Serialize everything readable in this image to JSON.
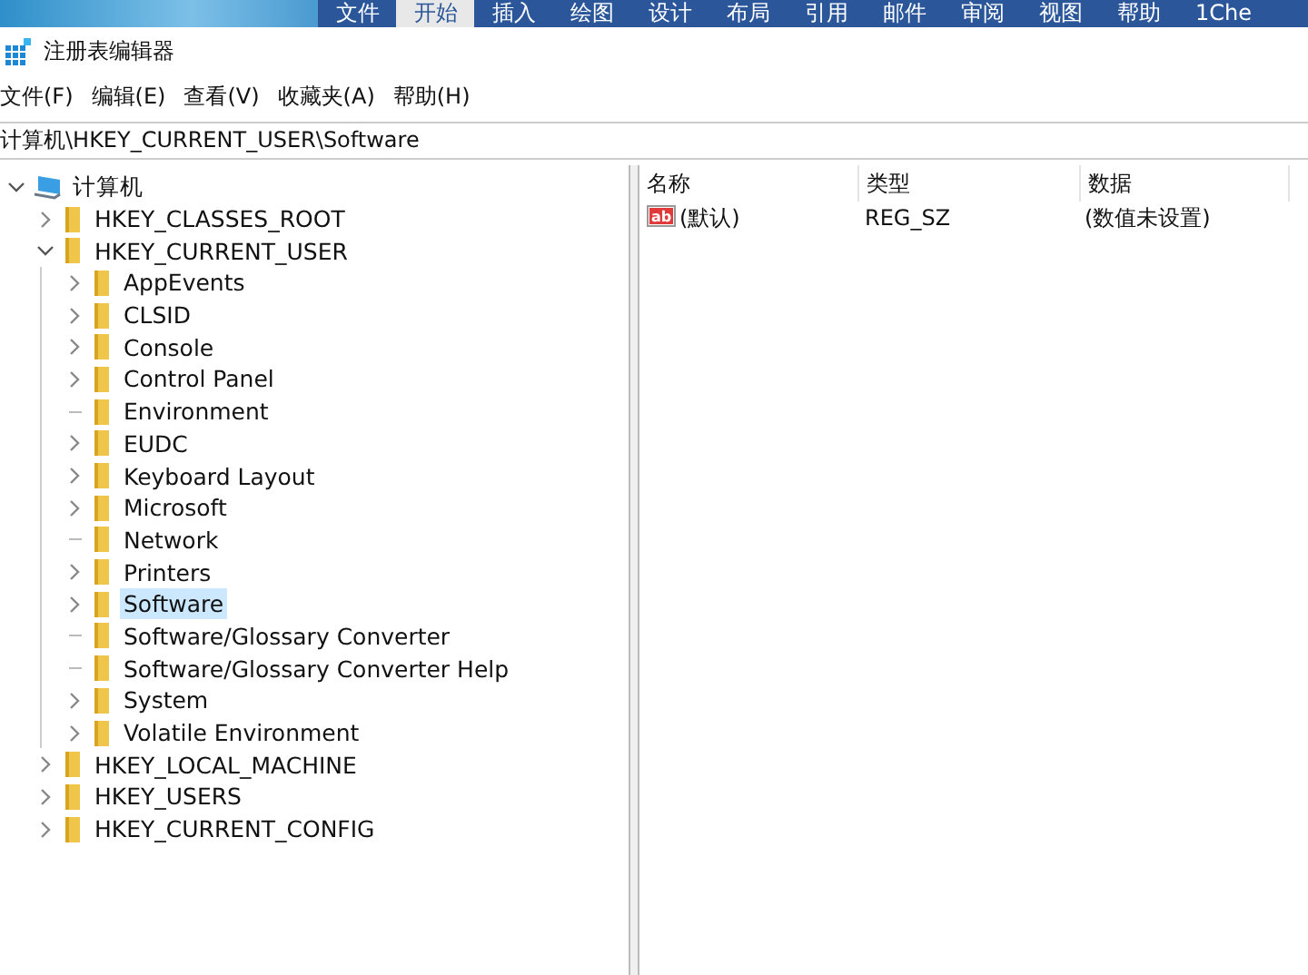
{
  "ribbon": {
    "tabs": [
      {
        "label": "文件",
        "selected": false
      },
      {
        "label": "开始",
        "selected": true
      },
      {
        "label": "插入",
        "selected": false
      },
      {
        "label": "绘图",
        "selected": false
      },
      {
        "label": "设计",
        "selected": false
      },
      {
        "label": "布局",
        "selected": false
      },
      {
        "label": "引用",
        "selected": false
      },
      {
        "label": "邮件",
        "selected": false
      },
      {
        "label": "审阅",
        "selected": false
      },
      {
        "label": "视图",
        "selected": false
      },
      {
        "label": "帮助",
        "selected": false
      },
      {
        "label": "1Che",
        "selected": false
      }
    ]
  },
  "window": {
    "title": "注册表编辑器"
  },
  "menu": [
    "文件(F)",
    "编辑(E)",
    "查看(V)",
    "收藏夹(A)",
    "帮助(H)"
  ],
  "address": "计算机\\HKEY_CURRENT_USER\\Software",
  "tree": [
    {
      "label": "计算机",
      "kind": "computer",
      "expanded": true,
      "selected": false,
      "children": [
        {
          "label": "HKEY_CLASSES_ROOT",
          "kind": "branch",
          "expanded": false,
          "selected": false
        },
        {
          "label": "HKEY_CURRENT_USER",
          "kind": "branch",
          "expanded": true,
          "selected": false,
          "children": [
            {
              "label": "AppEvents",
              "kind": "branch",
              "expanded": false,
              "selected": false
            },
            {
              "label": "CLSID",
              "kind": "branch",
              "expanded": false,
              "selected": false
            },
            {
              "label": "Console",
              "kind": "branch",
              "expanded": false,
              "selected": false
            },
            {
              "label": "Control Panel",
              "kind": "branch",
              "expanded": false,
              "selected": false
            },
            {
              "label": "Environment",
              "kind": "leaf",
              "expanded": false,
              "selected": false
            },
            {
              "label": "EUDC",
              "kind": "branch",
              "expanded": false,
              "selected": false
            },
            {
              "label": "Keyboard Layout",
              "kind": "branch",
              "expanded": false,
              "selected": false
            },
            {
              "label": "Microsoft",
              "kind": "branch",
              "expanded": false,
              "selected": false
            },
            {
              "label": "Network",
              "kind": "leaf",
              "expanded": false,
              "selected": false
            },
            {
              "label": "Printers",
              "kind": "branch",
              "expanded": false,
              "selected": false
            },
            {
              "label": "Software",
              "kind": "branch",
              "expanded": false,
              "selected": true
            },
            {
              "label": "Software/Glossary Converter",
              "kind": "leaf",
              "expanded": false,
              "selected": false
            },
            {
              "label": "Software/Glossary Converter Help",
              "kind": "leaf",
              "expanded": false,
              "selected": false
            },
            {
              "label": "System",
              "kind": "branch",
              "expanded": false,
              "selected": false
            },
            {
              "label": "Volatile Environment",
              "kind": "branch",
              "expanded": false,
              "selected": false
            }
          ]
        },
        {
          "label": "HKEY_LOCAL_MACHINE",
          "kind": "branch",
          "expanded": false,
          "selected": false
        },
        {
          "label": "HKEY_USERS",
          "kind": "branch",
          "expanded": false,
          "selected": false
        },
        {
          "label": "HKEY_CURRENT_CONFIG",
          "kind": "branch",
          "expanded": false,
          "selected": false
        }
      ]
    }
  ],
  "values": {
    "columns": [
      "名称",
      "类型",
      "数据"
    ],
    "rows": [
      {
        "icon": "ab",
        "name": "(默认)",
        "type": "REG_SZ",
        "data": "(数值未设置)"
      }
    ]
  }
}
